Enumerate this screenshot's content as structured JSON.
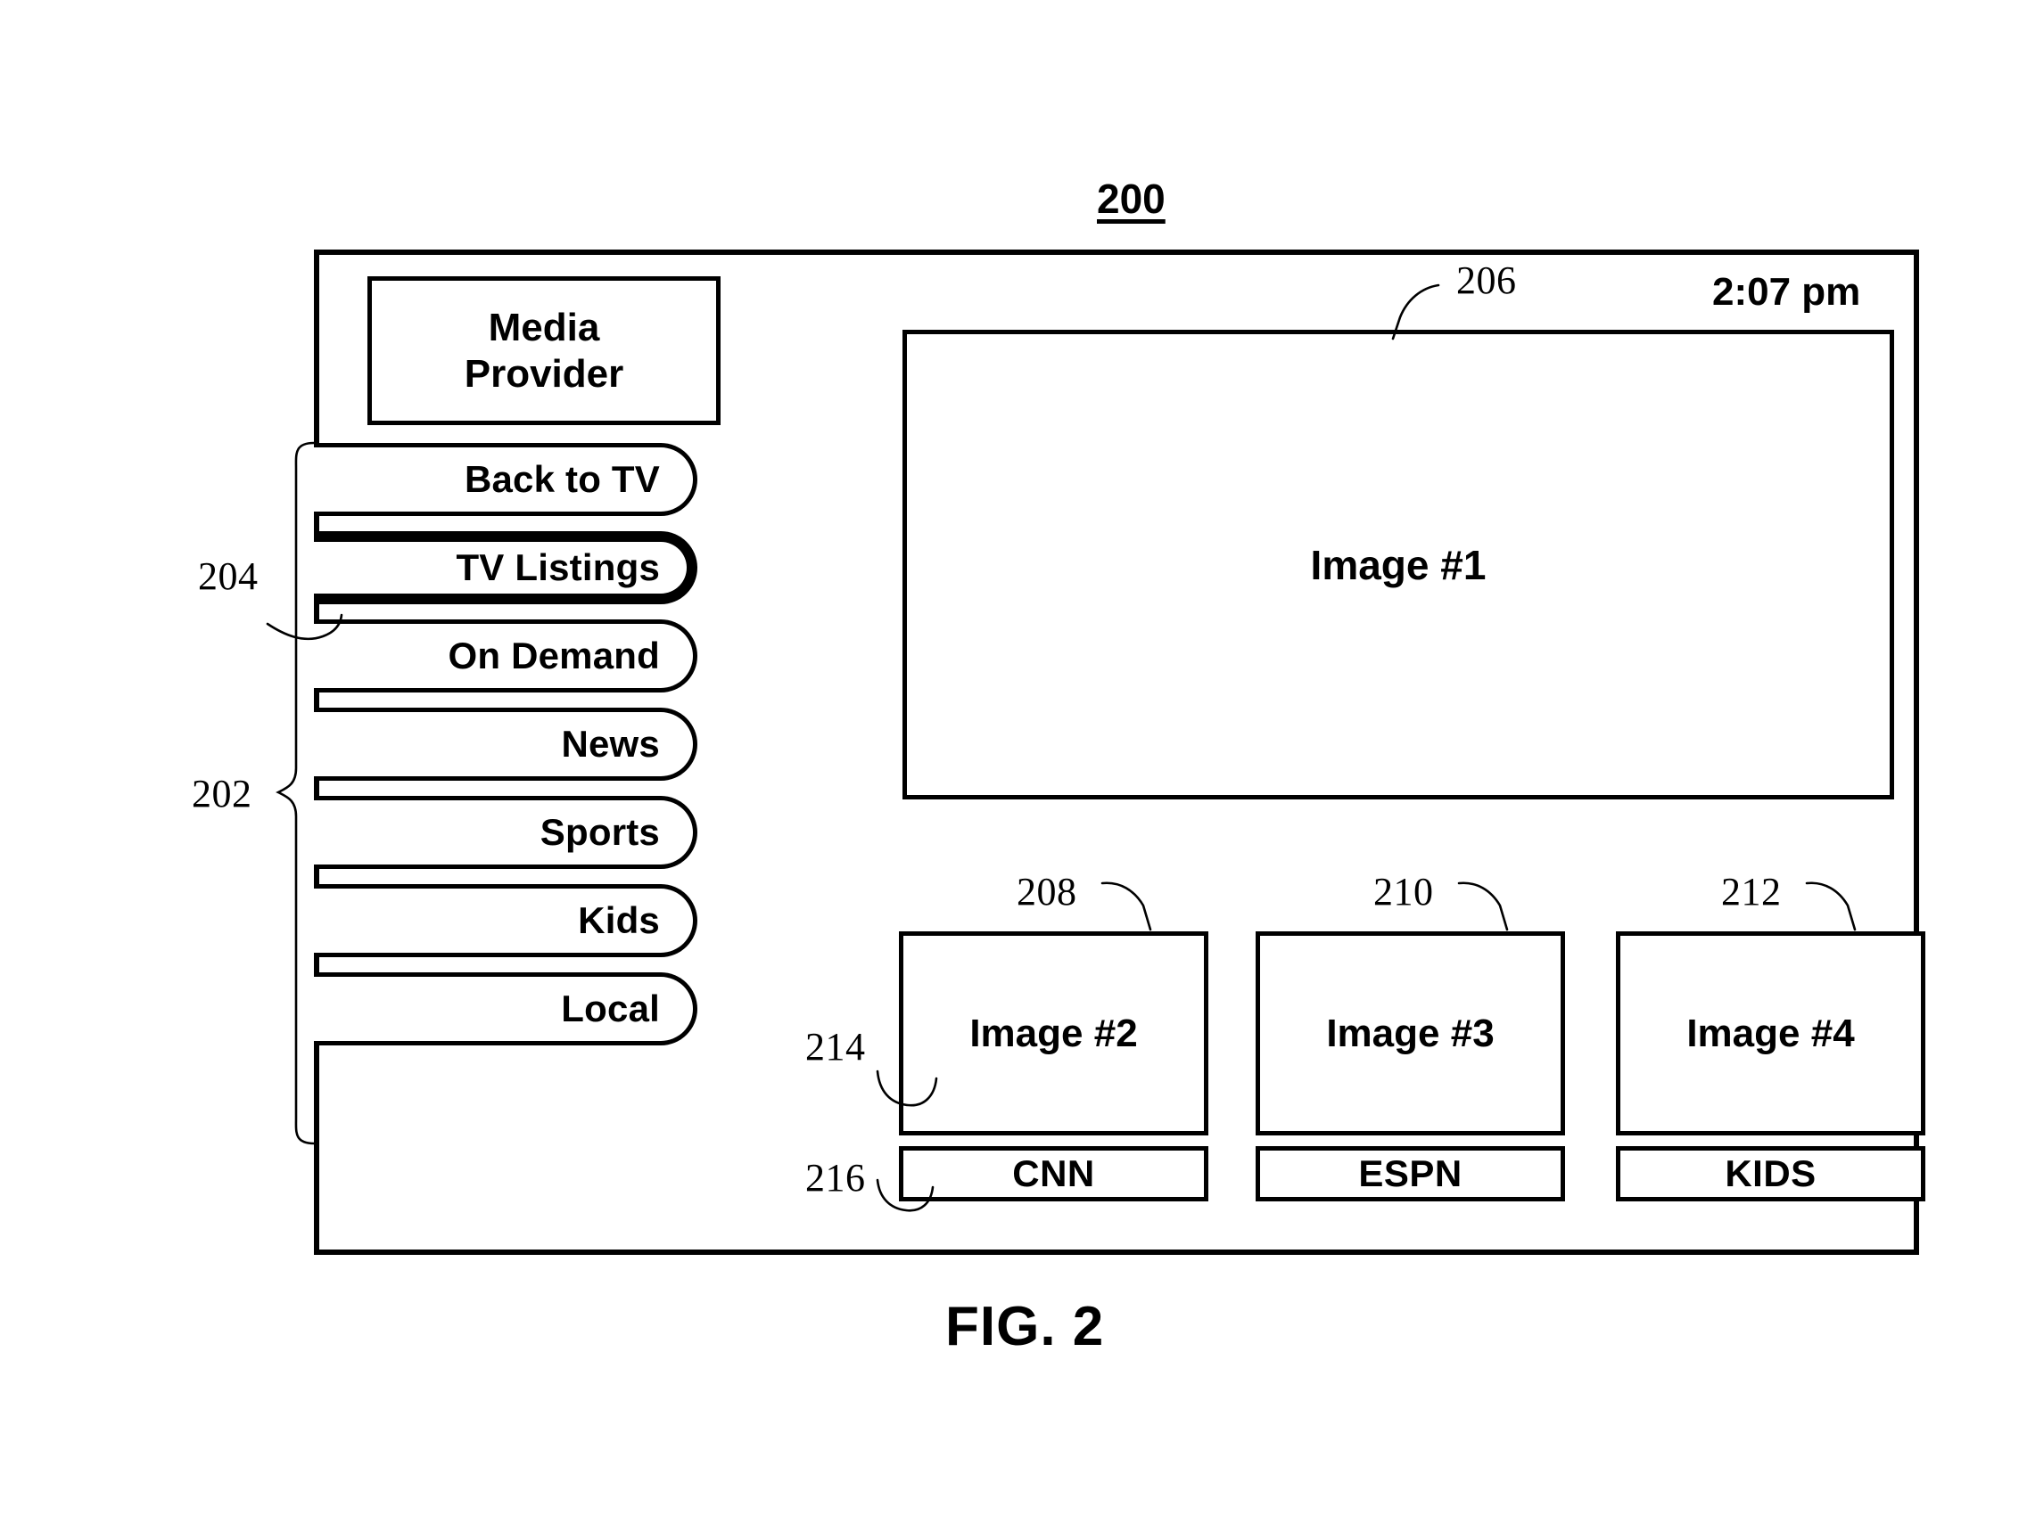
{
  "figure": {
    "reference_number": "200",
    "caption": "FIG. 2"
  },
  "screen": {
    "media_provider": {
      "label": "Media\nProvider"
    },
    "clock": {
      "time": "2:07 pm"
    },
    "nav_menu": {
      "items": [
        {
          "label": "Back to TV",
          "selected": false
        },
        {
          "label": "TV Listings",
          "selected": true
        },
        {
          "label": "On Demand",
          "selected": false
        },
        {
          "label": "News",
          "selected": false
        },
        {
          "label": "Sports",
          "selected": false
        },
        {
          "label": "Kids",
          "selected": false
        },
        {
          "label": "Local",
          "selected": false
        }
      ]
    },
    "hero_image": {
      "label": "Image #1"
    },
    "thumbnails": [
      {
        "image_label": "Image #2",
        "channel_label": "CNN"
      },
      {
        "image_label": "Image #3",
        "channel_label": "ESPN"
      },
      {
        "image_label": "Image #4",
        "channel_label": "KIDS"
      }
    ]
  },
  "callouts": {
    "nav_menu_group": "202",
    "selected_nav_item": "204",
    "hero_image": "206",
    "thumb_1": "208",
    "thumb_2": "210",
    "thumb_3": "212",
    "thumb_image_box": "214",
    "thumb_channel_box": "216"
  },
  "colors": {
    "line": "#000000",
    "background": "#ffffff"
  }
}
